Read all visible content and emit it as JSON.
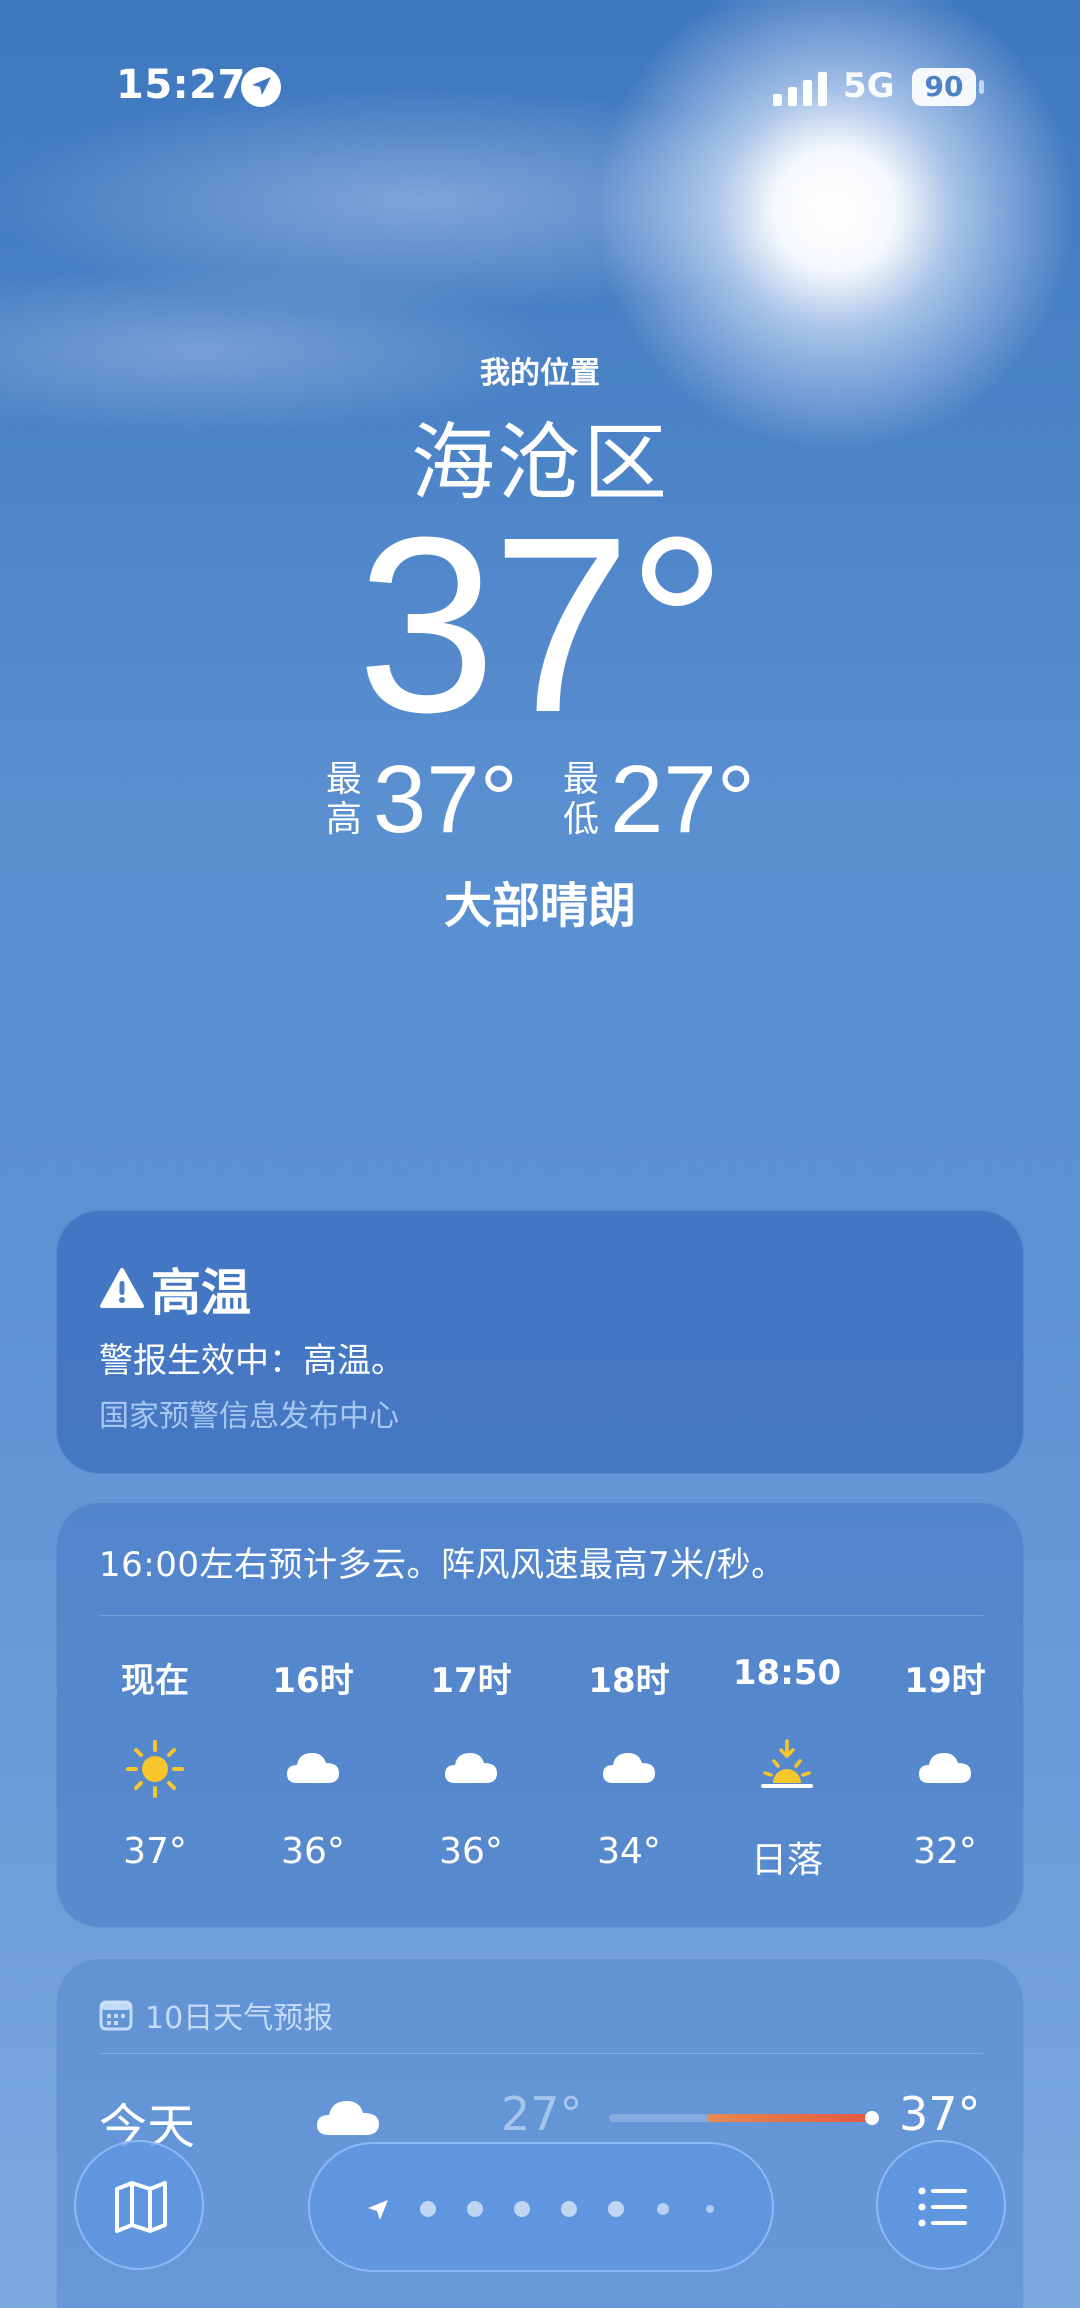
{
  "status_bar": {
    "time": "15:27",
    "network": "5G",
    "battery": "90",
    "icons": [
      "location-arrow-icon",
      "signal-icon",
      "battery-icon"
    ]
  },
  "header": {
    "my_location": "我的位置",
    "city": "海沧区",
    "temperature": "37°",
    "high_label_top": "最",
    "high_label_bottom": "高",
    "high_value": "37°",
    "low_label_top": "最",
    "low_label_bottom": "低",
    "low_value": "27°",
    "condition": "大部晴朗"
  },
  "alert": {
    "title": "高温",
    "body": "警报生效中：高温。",
    "source": "国家预警信息发布中心",
    "icon": "warning-icon"
  },
  "hourly": {
    "summary": "16:00左右预计多云。阵风风速最高7米/秒。",
    "items": [
      {
        "label": "现在",
        "icon": "sun-icon",
        "temp": "37°"
      },
      {
        "label": "16时",
        "icon": "cloud-icon",
        "temp": "36°"
      },
      {
        "label": "17时",
        "icon": "cloud-icon",
        "temp": "36°"
      },
      {
        "label": "18时",
        "icon": "cloud-icon",
        "temp": "34°"
      },
      {
        "label": "18:50",
        "icon": "sunset-icon",
        "temp": "日落"
      },
      {
        "label": "19时",
        "icon": "cloud-icon",
        "temp": "32°"
      }
    ]
  },
  "ten_day": {
    "header": "10日天气预报",
    "today": {
      "name": "今天",
      "icon": "cloud-icon",
      "low": "27°",
      "high": "37°",
      "range_fill_start": 0.36,
      "current_position": 1.0
    }
  },
  "toolbar": {
    "map_icon": "map-icon",
    "list_icon": "list-icon",
    "pages": 7,
    "current_page_icon": "location-arrow-icon"
  },
  "colors": {
    "sky_top": "#3f78c0",
    "sky_bottom": "#7ba9e0",
    "sun": "#f7c62b",
    "range_bar": "#e2563f"
  }
}
